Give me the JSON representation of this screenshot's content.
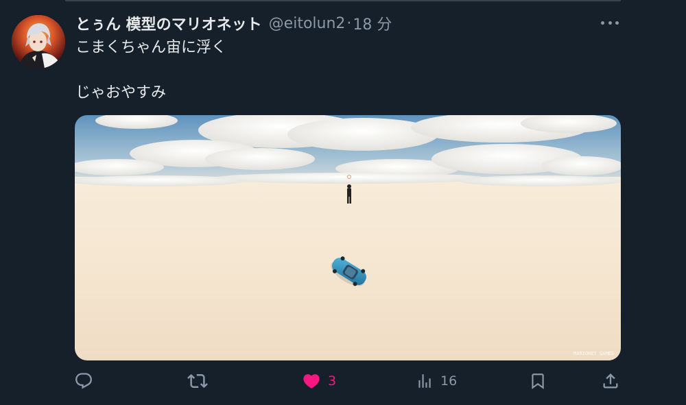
{
  "user": {
    "display_name": "とぅん 模型のマリオネット",
    "handle": "@eitolun2",
    "separator": "·",
    "time": "18 分"
  },
  "tweet": {
    "line1": "こまくちゃん宙に浮く",
    "line2": "じゃおやすみ"
  },
  "media": {
    "watermark": "MARIONET GAMES"
  },
  "actions": {
    "reply_count": "",
    "retweet_count": "",
    "like_count": "3",
    "views_count": "16",
    "liked": true
  },
  "colors": {
    "background": "#15202b",
    "text": "#e7e9ea",
    "secondary": "#8b98a5",
    "like": "#f91880"
  },
  "icons": {
    "reply": "reply-icon",
    "retweet": "retweet-icon",
    "like": "heart-icon",
    "views": "views-icon",
    "bookmark": "bookmark-icon",
    "share": "share-icon",
    "more": "more-icon"
  }
}
